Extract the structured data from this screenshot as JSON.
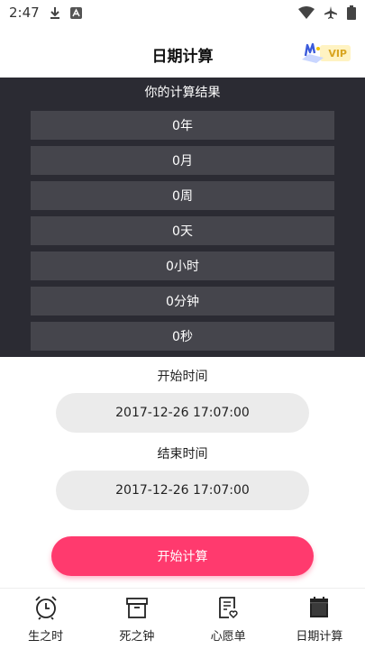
{
  "status_bar": {
    "time": "2:47",
    "icons": [
      "download-icon",
      "font-icon",
      "wifi-icon",
      "airplane-icon",
      "battery-icon"
    ]
  },
  "header": {
    "title": "日期计算",
    "vip_label": "VIP"
  },
  "result": {
    "heading": "你的计算结果",
    "rows": [
      "0年",
      "0月",
      "0周",
      "0天",
      "0小时",
      "0分钟",
      "0秒"
    ]
  },
  "start_time": {
    "label": "开始时间",
    "value": "2017-12-26 17:07:00"
  },
  "end_time": {
    "label": "结束时间",
    "value": "2017-12-26 17:07:00"
  },
  "calculate_button": {
    "label": "开始计算"
  },
  "bottom_nav": {
    "items": [
      {
        "label": "生之时",
        "icon": "alarm-clock-icon"
      },
      {
        "label": "死之钟",
        "icon": "box-icon"
      },
      {
        "label": "心愿单",
        "icon": "wish-list-icon"
      },
      {
        "label": "日期计算",
        "icon": "calendar-icon"
      }
    ]
  },
  "colors": {
    "accent": "#ff3a6e",
    "panel_bg": "#2b2b33",
    "row_bg": "#45454c",
    "field_bg": "#ebebeb"
  }
}
